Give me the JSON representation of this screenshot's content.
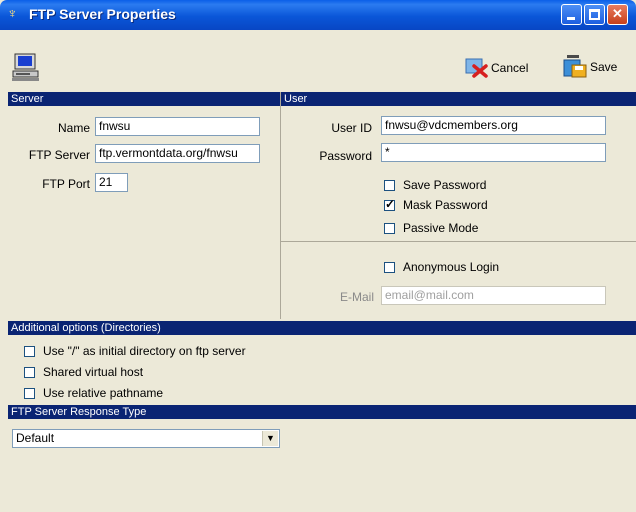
{
  "window": {
    "title": "FTP Server Properties",
    "title_icon": "ftp-server-icon"
  },
  "toolbar": {
    "computer_icon": "computer-icon",
    "cancel_label": "Cancel",
    "cancel_icon": "cancel-icon",
    "save_label": "Save",
    "save_icon": "save-icon"
  },
  "server": {
    "header": "Server",
    "name_label": "Name",
    "name_value": "fnwsu",
    "ftp_server_label": "FTP Server",
    "ftp_server_value": "ftp.vermontdata.org/fnwsu",
    "ftp_port_label": "FTP Port",
    "ftp_port_value": "21"
  },
  "user": {
    "header": "User",
    "user_id_label": "User ID",
    "user_id_value": "fnwsu@vdcmembers.org",
    "password_label": "Password",
    "password_value": "*",
    "save_password_label": "Save Password",
    "save_password_checked": false,
    "mask_password_label": "Mask Password",
    "mask_password_checked": true,
    "passive_mode_label": "Passive Mode",
    "passive_mode_checked": false,
    "anonymous_login_label": "Anonymous Login",
    "anonymous_login_checked": false,
    "email_label": "E-Mail",
    "email_placeholder": "email@mail.com"
  },
  "additional": {
    "header": "Additional options (Directories)",
    "option1_label": "Use \"/\" as initial directory on ftp server",
    "option2_label": "Shared virtual host",
    "option3_label": "Use relative pathname"
  },
  "response": {
    "header": "FTP Server Response Type",
    "selected": "Default"
  },
  "colors": {
    "header_bg": "#0a2473",
    "title_bar": "#0a56d8",
    "window_bg": "#ece9d8"
  }
}
